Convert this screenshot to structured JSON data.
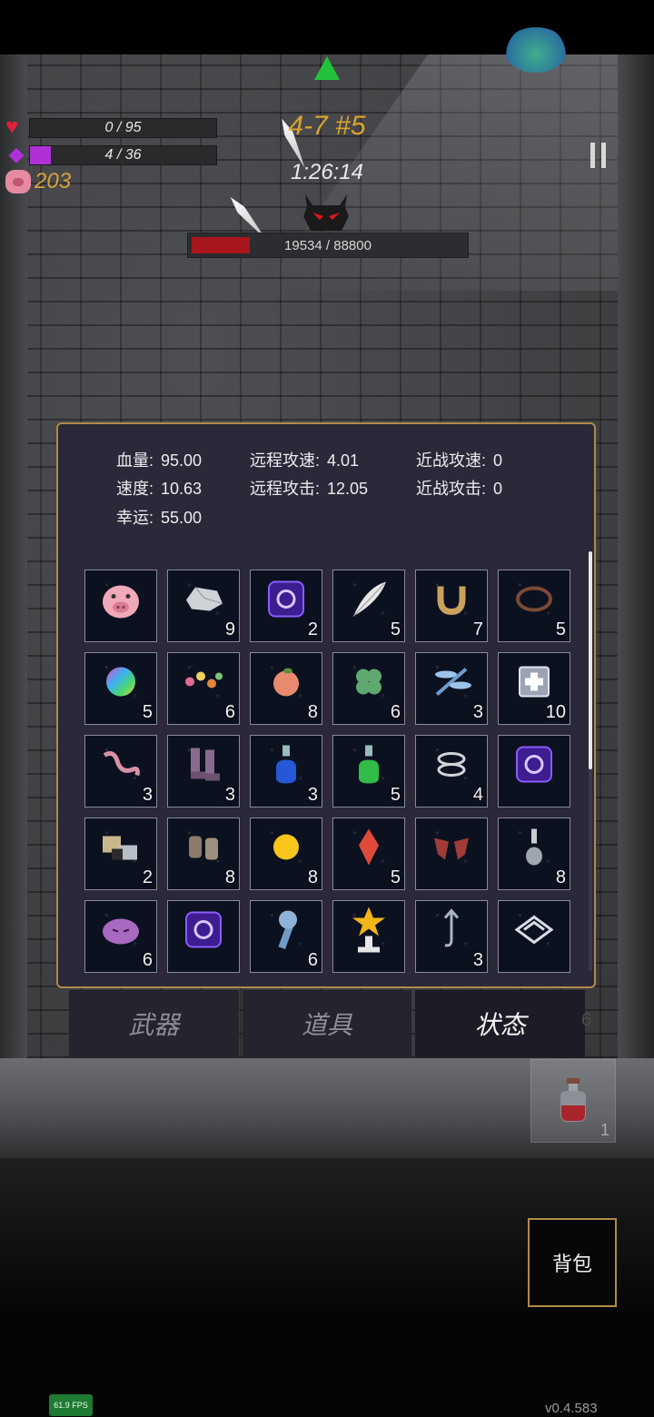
{
  "hud": {
    "hp": {
      "text": "0 / 95",
      "fraction": 0.0,
      "color": "#e0213b"
    },
    "mp": {
      "text": "4 / 36",
      "fraction": 0.11,
      "color": "#b030d8"
    },
    "gold": "203",
    "level": "4-7 #5",
    "timer": "1:26:14",
    "boss": {
      "text": "19534 / 88800",
      "fraction": 0.22,
      "color": "#a8161c"
    }
  },
  "stats": {
    "hp_label": "血量:",
    "hp_value": "95.00",
    "speed_label": "速度:",
    "speed_value": "10.63",
    "luck_label": "幸运:",
    "luck_value": "55.00",
    "ranged_rate_label": "远程攻速:",
    "ranged_rate_value": "4.01",
    "ranged_atk_label": "远程攻击:",
    "ranged_atk_value": "12.05",
    "melee_rate_label": "近战攻速:",
    "melee_rate_value": "0",
    "melee_atk_label": "近战攻击:",
    "melee_atk_value": "0"
  },
  "items": [
    {
      "name": "piggy-bank-icon",
      "count": ""
    },
    {
      "name": "rock-icon",
      "count": "9"
    },
    {
      "name": "purple-rune-icon",
      "count": "2"
    },
    {
      "name": "feather-icon",
      "count": "5"
    },
    {
      "name": "horseshoe-icon",
      "count": "7"
    },
    {
      "name": "thorn-wreath-icon",
      "count": "5"
    },
    {
      "name": "rainbow-orb-icon",
      "count": "5"
    },
    {
      "name": "flower-garland-icon",
      "count": "6"
    },
    {
      "name": "peach-icon",
      "count": "8"
    },
    {
      "name": "clover-icon",
      "count": "6"
    },
    {
      "name": "dragonfly-icon",
      "count": "3"
    },
    {
      "name": "medkit-icon",
      "count": "10"
    },
    {
      "name": "worm-icon",
      "count": "3"
    },
    {
      "name": "boots-icon",
      "count": "3"
    },
    {
      "name": "blue-potion-icon",
      "count": "3"
    },
    {
      "name": "green-potion-icon",
      "count": "5"
    },
    {
      "name": "silver-rings-icon",
      "count": "4"
    },
    {
      "name": "purple-rune-icon",
      "count": ""
    },
    {
      "name": "ore-chunks-icon",
      "count": "2"
    },
    {
      "name": "gauntlets-icon",
      "count": "8"
    },
    {
      "name": "gold-sun-icon",
      "count": "8"
    },
    {
      "name": "red-crystal-icon",
      "count": "5"
    },
    {
      "name": "red-wings-icon",
      "count": ""
    },
    {
      "name": "vial-icon",
      "count": "8"
    },
    {
      "name": "purple-slime-icon",
      "count": "6"
    },
    {
      "name": "purple-rune-icon",
      "count": ""
    },
    {
      "name": "blue-wrench-icon",
      "count": "6"
    },
    {
      "name": "star-trophy-icon",
      "count": ""
    },
    {
      "name": "anchor-hook-icon",
      "count": "3"
    },
    {
      "name": "chevron-crystal-icon",
      "count": ""
    }
  ],
  "tabs": [
    "武器",
    "道具",
    "状态"
  ],
  "active_tab": 2,
  "tab_extra_count": "6",
  "potion_count": "1",
  "bag_label": "背包",
  "fps": "61.9 FPS",
  "version": "v0.4.583"
}
